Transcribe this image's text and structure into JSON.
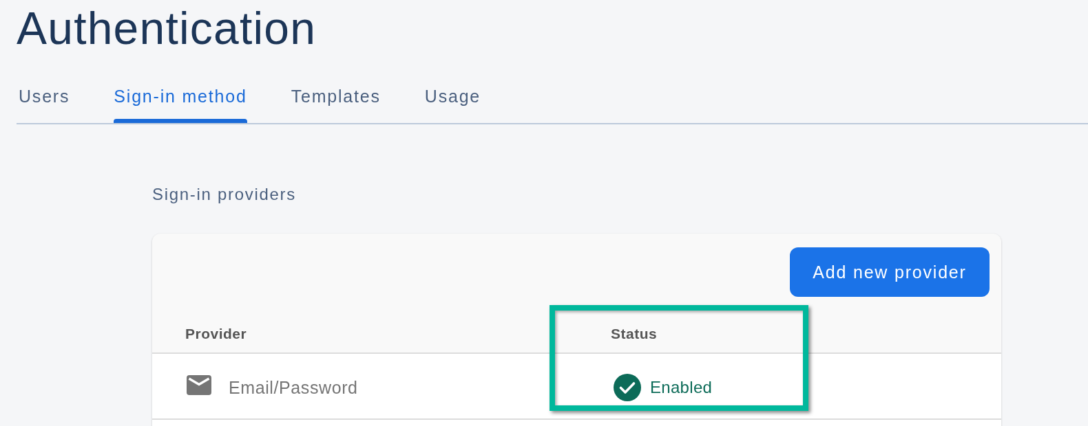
{
  "page": {
    "title": "Authentication"
  },
  "tabs": [
    {
      "label": "Users",
      "selected": false
    },
    {
      "label": "Sign-in method",
      "selected": true
    },
    {
      "label": "Templates",
      "selected": false
    },
    {
      "label": "Usage",
      "selected": false
    }
  ],
  "providers": {
    "heading": "Sign-in providers",
    "add_button": "Add new provider",
    "columns": [
      "Provider",
      "Status"
    ],
    "rows": [
      {
        "name": "Email/Password",
        "status": "Enabled",
        "enabled": true
      }
    ]
  }
}
